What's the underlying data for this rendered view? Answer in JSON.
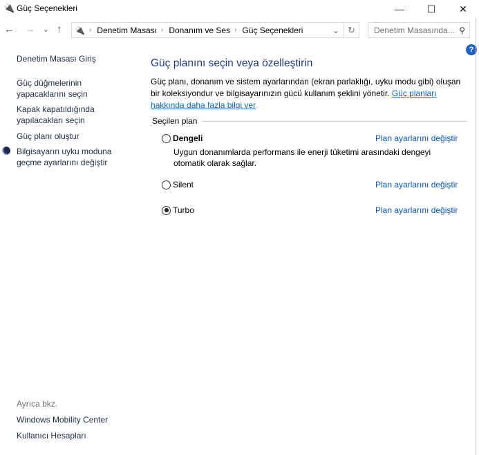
{
  "window": {
    "title": "Güç Seçenekleri",
    "minimize": "—",
    "maximize": "☐",
    "close": "✕"
  },
  "toolbar": {
    "back": "←",
    "forward": "→",
    "recent": "⌄",
    "up": "↑",
    "refresh": "↻",
    "dropdown": "⌄"
  },
  "breadcrumb": [
    "Denetim Masası",
    "Donanım ve Ses",
    "Güç Seçenekleri"
  ],
  "search": {
    "placeholder": "Denetim Masasında...",
    "icon": "⚲"
  },
  "sidebar": {
    "home": "Denetim Masası Giriş",
    "items": [
      "Güç düğmelerinin yapacaklarını seçin",
      "Kapak kapatıldığında yapılacakları seçin",
      "Güç planı oluştur",
      "Bilgisayarın uyku moduna geçme ayarlarını değiştir"
    ],
    "see_also": "Ayrıca bkz.",
    "see_also_items": [
      "Windows Mobility Center",
      "Kullanıcı Hesapları"
    ]
  },
  "main": {
    "help": "?",
    "title": "Güç planını seçin veya özelleştirin",
    "description": "Güç planı, donanım ve sistem ayarlarından (ekran parlaklığı, uyku modu gibi) oluşan bir koleksiyondur ve bilgisayarınızın gücü kullanım şeklini yönetir. ",
    "learn_more": "Güç planları hakkında daha fazla bilgi ver",
    "section": "Seçilen plan",
    "plans": [
      {
        "name": "Dengeli",
        "desc": "Uygun donanımlarda performans ile enerji tüketimi arasındaki dengeyi otomatik olarak sağlar.",
        "link": "Plan ayarlarını değiştir",
        "selected": false
      },
      {
        "name": "Silent",
        "link": "Plan ayarlarını değiştir",
        "selected": false
      },
      {
        "name": "Turbo",
        "link": "Plan ayarlarını değiştir",
        "selected": true
      }
    ]
  }
}
